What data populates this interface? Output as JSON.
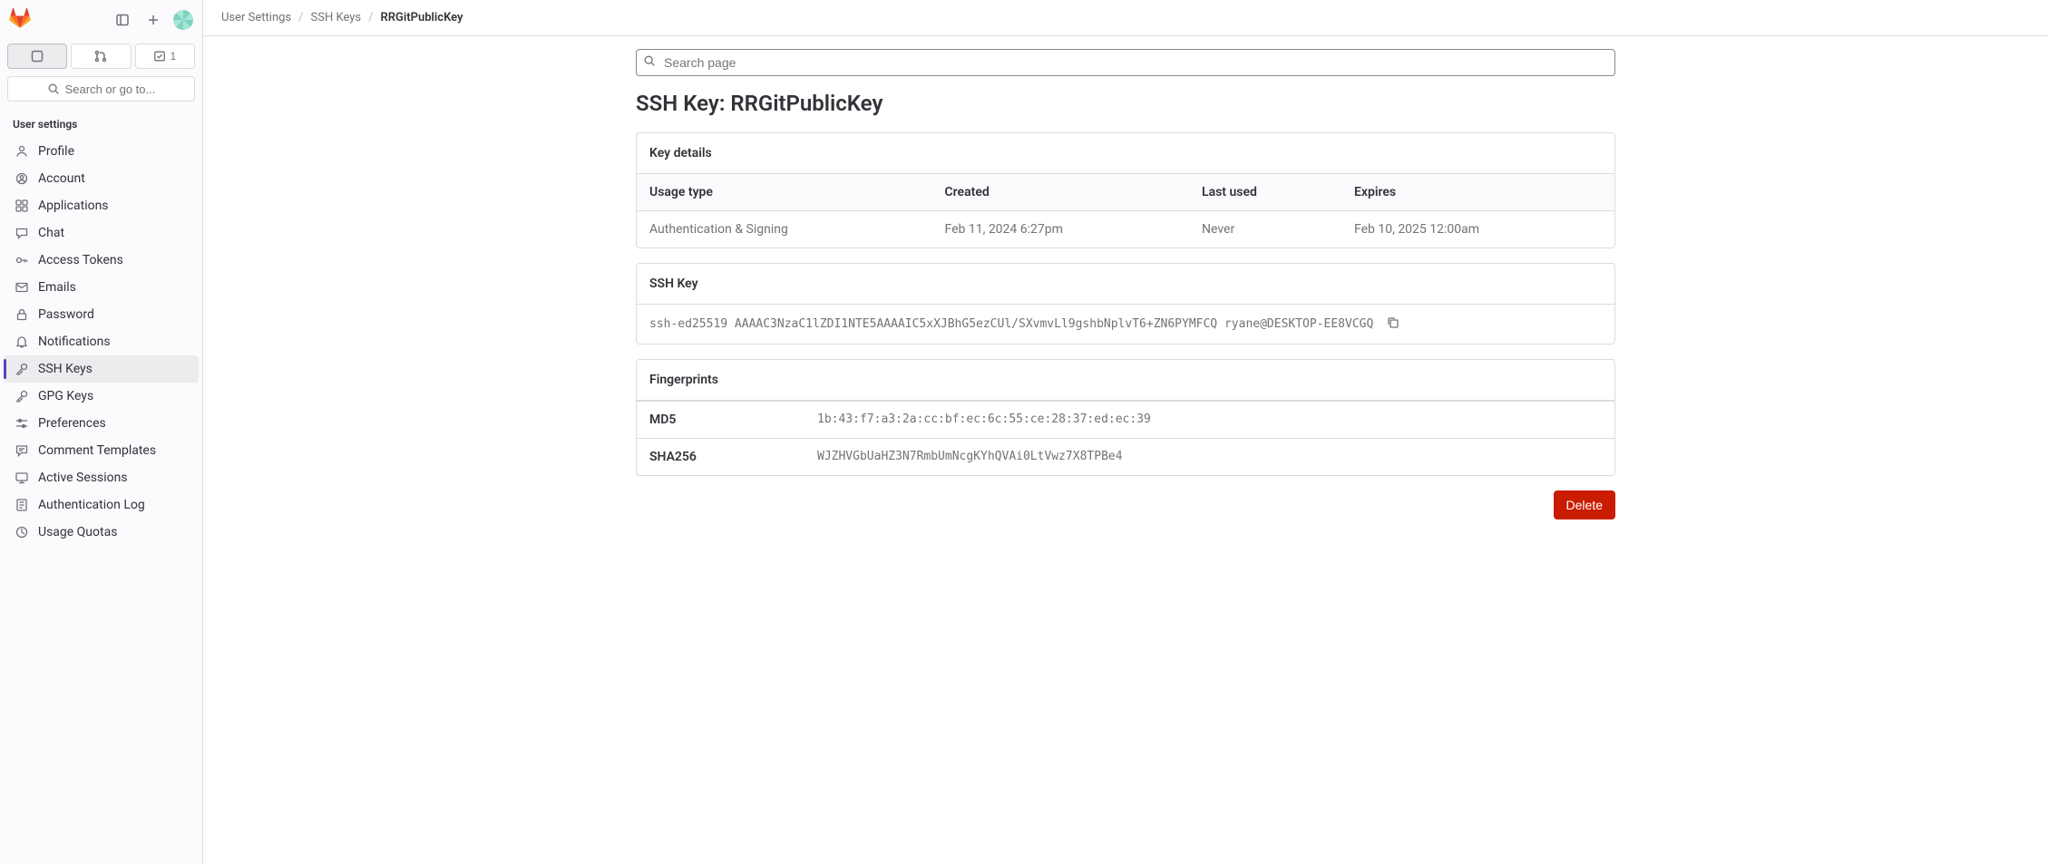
{
  "sidebar": {
    "search_label": "Search or go to...",
    "badge_count": "1",
    "section_title": "User settings",
    "items": [
      {
        "label": "Profile"
      },
      {
        "label": "Account"
      },
      {
        "label": "Applications"
      },
      {
        "label": "Chat"
      },
      {
        "label": "Access Tokens"
      },
      {
        "label": "Emails"
      },
      {
        "label": "Password"
      },
      {
        "label": "Notifications"
      },
      {
        "label": "SSH Keys"
      },
      {
        "label": "GPG Keys"
      },
      {
        "label": "Preferences"
      },
      {
        "label": "Comment Templates"
      },
      {
        "label": "Active Sessions"
      },
      {
        "label": "Authentication Log"
      },
      {
        "label": "Usage Quotas"
      }
    ]
  },
  "breadcrumb": {
    "a": "User Settings",
    "b": "SSH Keys",
    "c": "RRGitPublicKey"
  },
  "search_placeholder": "Search page",
  "page_title": "SSH Key: RRGitPublicKey",
  "key_details": {
    "header": "Key details",
    "cols": {
      "usage": "Usage type",
      "created": "Created",
      "last_used": "Last used",
      "expires": "Expires"
    },
    "row": {
      "usage": "Authentication & Signing",
      "created": "Feb 11, 2024 6:27pm",
      "last_used": "Never",
      "expires": "Feb 10, 2025 12:00am"
    }
  },
  "ssh_key": {
    "header": "SSH Key",
    "value": "ssh-ed25519 AAAAC3NzaC1lZDI1NTE5AAAAIC5xXJBhG5ezCUl/SXvmvLl9gshbNplvT6+ZN6PYMFCQ ryane@DESKTOP-EE8VCGQ"
  },
  "fingerprints": {
    "header": "Fingerprints",
    "md5_label": "MD5",
    "md5_value": "1b:43:f7:a3:2a:cc:bf:ec:6c:55:ce:28:37:ed:ec:39",
    "sha_label": "SHA256",
    "sha_value": "WJZHVGbUaHZ3N7RmbUmNcgKYhQVAi0LtVwz7X8TPBe4"
  },
  "delete_label": "Delete"
}
